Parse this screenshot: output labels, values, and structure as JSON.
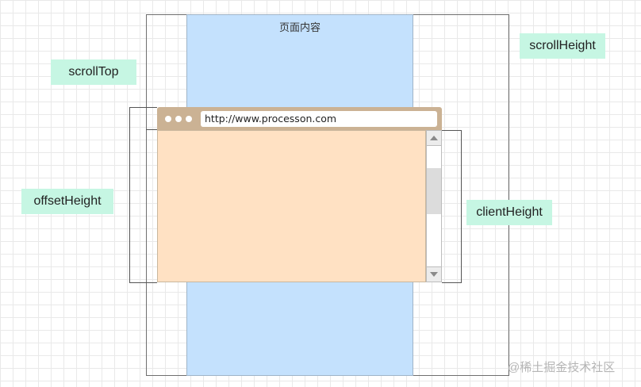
{
  "page": {
    "content_label": "页面内容"
  },
  "labels": {
    "scrollTop": "scrollTop",
    "scrollHeight": "scrollHeight",
    "offsetHeight": "offsetHeight",
    "clientHeight": "clientHeight"
  },
  "browser": {
    "url": "http://www.processon.com"
  },
  "watermark": "@稀土掘金技术社区",
  "colors": {
    "page_content": "#c4e1fd",
    "label_bg": "#c6f6e3",
    "browser_bar": "#cbb294",
    "viewport": "#ffe1c3"
  }
}
